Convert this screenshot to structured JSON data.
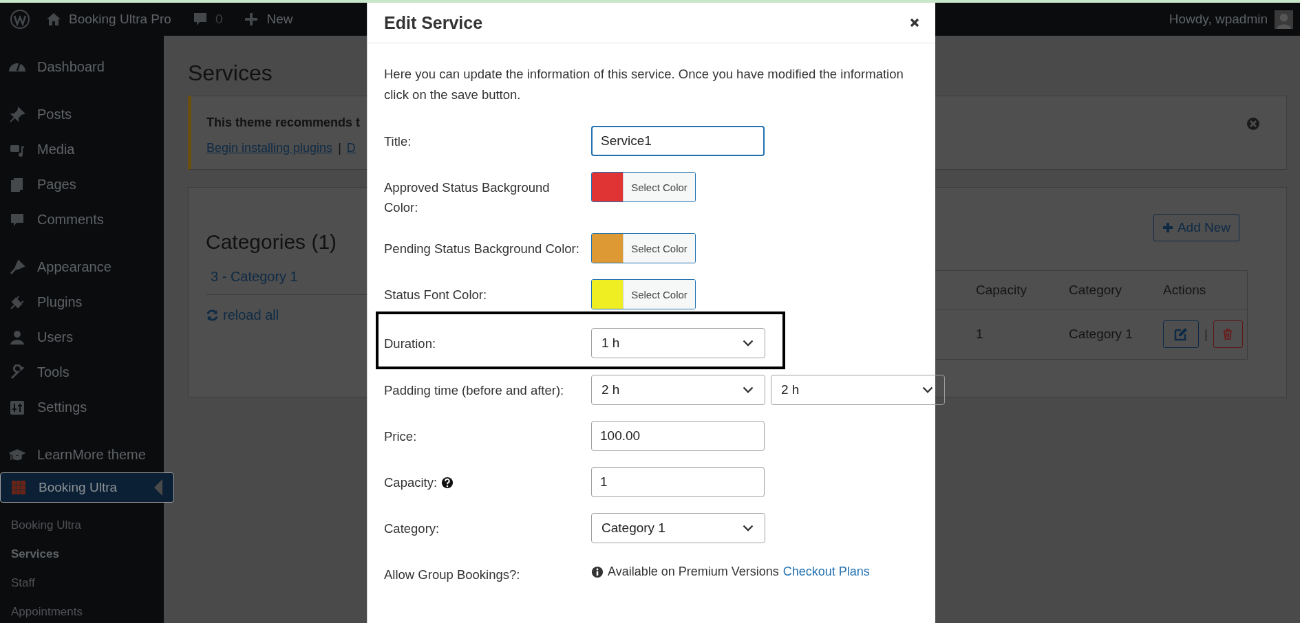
{
  "admin_bar": {
    "site_name": "Booking Ultra Pro",
    "comments_count": "0",
    "new_label": "New",
    "greeting": "Howdy, wpadmin"
  },
  "sidebar": {
    "menu_groups": [
      {
        "items": [
          {
            "label": "Dashboard",
            "selected": false
          }
        ]
      },
      {
        "items": [
          {
            "label": "Posts",
            "selected": false
          },
          {
            "label": "Media",
            "selected": false
          },
          {
            "label": "Pages",
            "selected": false
          },
          {
            "label": "Comments",
            "selected": false
          }
        ]
      },
      {
        "items": [
          {
            "label": "Appearance",
            "selected": false
          },
          {
            "label": "Plugins",
            "selected": false
          },
          {
            "label": "Users",
            "selected": false
          },
          {
            "label": "Tools",
            "selected": false
          },
          {
            "label": "Settings",
            "selected": false
          }
        ]
      },
      {
        "items": [
          {
            "label": "LearnMore theme",
            "selected": false
          },
          {
            "label": "Booking Ultra",
            "selected": true
          }
        ]
      }
    ],
    "submenu": [
      {
        "label": "Booking Ultra",
        "selected": false
      },
      {
        "label": "Services",
        "selected": true
      },
      {
        "label": "Staff",
        "selected": false
      },
      {
        "label": "Appointments",
        "selected": false
      }
    ]
  },
  "page": {
    "title": "Services",
    "notice": {
      "text": "This theme recommends t",
      "links": [
        "Begin installing plugins",
        "D"
      ],
      "separator": "|"
    },
    "categories": {
      "title": "Categories (1)",
      "items": [
        "3 - Category 1"
      ],
      "reload": "reload all",
      "add_button": "Add New",
      "table": {
        "columns": [
          "Capacity",
          "Category",
          "Actions"
        ],
        "rows": [
          {
            "capacity": "1",
            "category": "Category 1",
            "separator": "|"
          }
        ]
      }
    }
  },
  "modal": {
    "title": "Edit Service",
    "description": "Here you can update the information of this service. Once you have modified the information click on the save button.",
    "fields": [
      {
        "kind": "text",
        "label": "Title:",
        "value": "Service1",
        "focused": true,
        "help": false,
        "highlighted": false
      },
      {
        "kind": "color",
        "label": "Approved Status Background Color:",
        "color": "#e03333",
        "button": "Select Color",
        "highlighted": false
      },
      {
        "kind": "color",
        "label": "Pending Status Background Color:",
        "color": "#dd9933",
        "button": "Select Color",
        "highlighted": false
      },
      {
        "kind": "color",
        "label": "Status Font Color:",
        "color": "#eeee22",
        "button": "Select Color",
        "highlighted": false
      },
      {
        "kind": "select",
        "label": "Duration:",
        "values": [
          "1 h"
        ],
        "highlighted": true
      },
      {
        "kind": "select",
        "label": "Padding time (before and after):",
        "values": [
          "2 h",
          "2 h"
        ],
        "highlighted": false
      },
      {
        "kind": "text",
        "label": "Price:",
        "value": "100.00",
        "focused": false,
        "help": false,
        "highlighted": false
      },
      {
        "kind": "text",
        "label": "Capacity:",
        "value": "1",
        "focused": false,
        "help": true,
        "highlighted": false
      },
      {
        "kind": "select",
        "label": "Category:",
        "values": [
          "Category 1"
        ],
        "highlighted": false
      },
      {
        "kind": "notice",
        "label": "Allow Group Bookings?:",
        "text": "Available on Premium Versions",
        "link": "Checkout Plans",
        "highlighted": false
      }
    ]
  }
}
